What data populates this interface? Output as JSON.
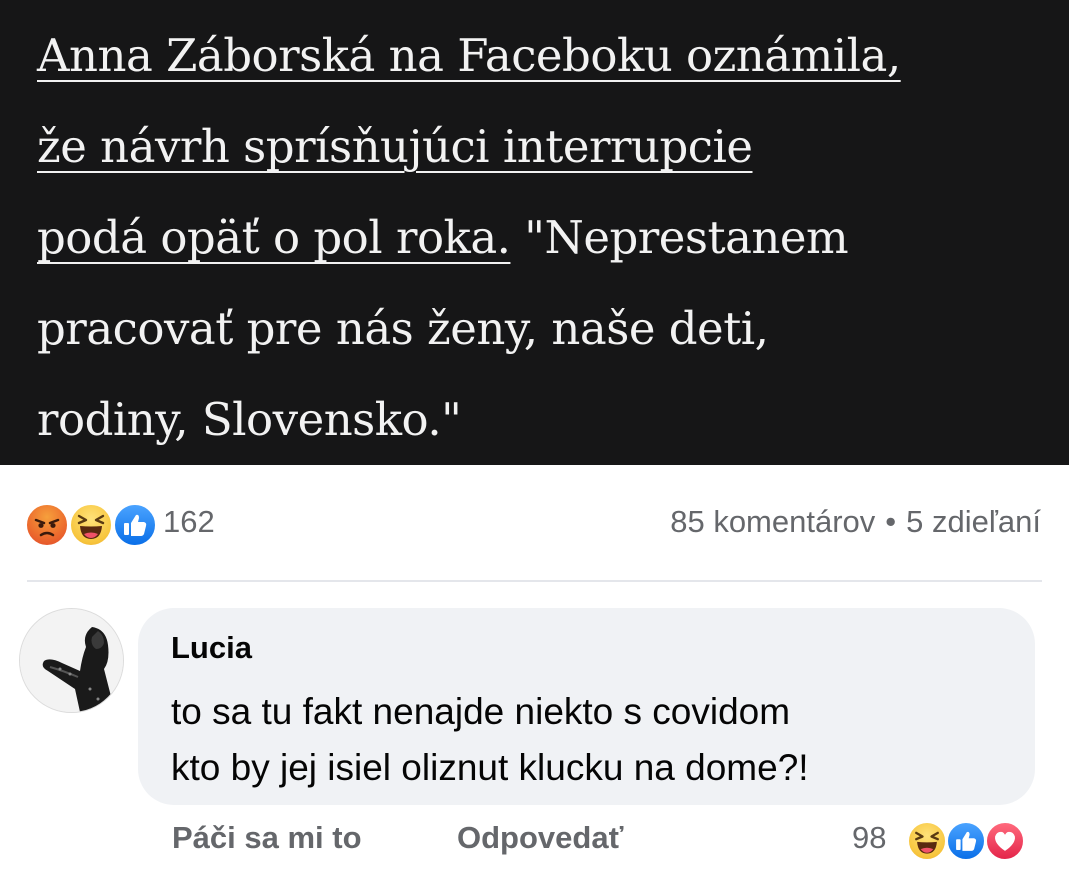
{
  "post": {
    "link_text": "Anna Záborská na Faceboku oznámila, že návrh sprísňujúci interrupcie podá opäť o pol roka.",
    "link_line1": "Anna Záborská na Faceboku oznámila,",
    "link_line2": "že návrh sprísňujúci interrupcie",
    "link_line3": "podá opäť o pol roka.",
    "quote_part1": " \"Neprestanem",
    "quote_line2": "pracovať pre nás ženy, naše deti,",
    "quote_line3": "rodiny, Slovensko.\""
  },
  "reactions": {
    "icons": [
      "angry-icon",
      "haha-icon",
      "like-icon"
    ],
    "count": "162"
  },
  "stats": {
    "comments": "85 komentárov",
    "separator": "•",
    "shares": "5 zdieľaní"
  },
  "comment": {
    "author": "Lucia",
    "text_line1": "to sa tu fakt nenajde niekto s covidom",
    "text_line2": "kto by jej isiel oliznut klucku na dome?!",
    "actions": {
      "like_label": "Páči sa mi to",
      "reply_label": "Odpovedať"
    },
    "reaction_count": "98",
    "reaction_icons": [
      "haha-icon",
      "like-icon",
      "love-icon"
    ]
  },
  "colors": {
    "post_background": "#161617",
    "post_text": "#f2f2f2",
    "secondary_text": "#65676b",
    "bubble_background": "#f0f2f5",
    "like_blue": "#0a6fe8"
  }
}
